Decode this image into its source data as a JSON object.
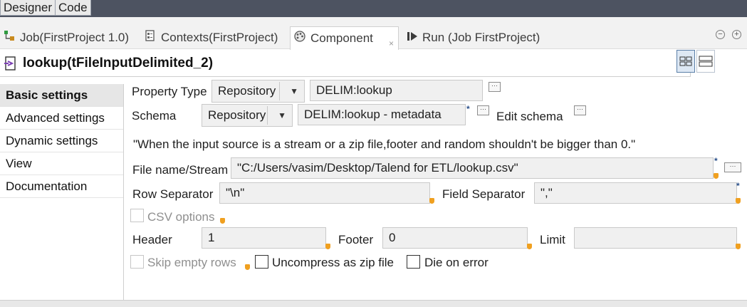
{
  "editor_tabs": {
    "designer": "Designer",
    "code": "Code"
  },
  "view_tabs": [
    {
      "label": "Job(FirstProject 1.0)",
      "icon": "job-icon"
    },
    {
      "label": "Contexts(FirstProject)",
      "icon": "contexts-icon"
    },
    {
      "label": "Component",
      "icon": "component-palette-icon",
      "close": "×"
    },
    {
      "label": "Run (Job FirstProject)",
      "icon": "run-icon"
    }
  ],
  "window_controls": {
    "minimize": "−",
    "maximize": "+"
  },
  "component": {
    "title": "lookup(tFileInputDelimited_2)",
    "icon": "file-input-icon"
  },
  "nav": {
    "items": [
      "Basic settings",
      "Advanced settings",
      "Dynamic settings",
      "View",
      "Documentation"
    ],
    "active_index": 0
  },
  "form": {
    "property_type": {
      "label": "Property Type",
      "mode": "Repository",
      "value": "DELIM:lookup"
    },
    "schema": {
      "label": "Schema",
      "mode": "Repository",
      "value": "DELIM:lookup - metadata",
      "edit_label": "Edit schema"
    },
    "warning": "\"When the input source is a stream or a zip file,footer and random shouldn't be bigger than 0.\"",
    "file_name": {
      "label": "File name/Stream",
      "value": "\"C:/Users/vasim/Desktop/Talend for ETL/lookup.csv\""
    },
    "row_separator": {
      "label": "Row Separator",
      "value": "\"\\n\""
    },
    "field_separator": {
      "label": "Field Separator",
      "value": "\",\""
    },
    "csv_options": {
      "label": "CSV options",
      "checked": false,
      "enabled": false
    },
    "header": {
      "label": "Header",
      "value": "1"
    },
    "footer": {
      "label": "Footer",
      "value": "0"
    },
    "limit": {
      "label": "Limit",
      "value": ""
    },
    "skip_empty_rows": {
      "label": "Skip empty rows",
      "checked": false,
      "enabled": false
    },
    "uncompress_zip": {
      "label": "Uncompress as zip file",
      "checked": false
    },
    "die_on_error": {
      "label": "Die on error",
      "checked": false
    }
  },
  "colors": {
    "top_strip": "#4d5361",
    "accent_border": "#5b7fa8",
    "hint": "#f0a020"
  }
}
